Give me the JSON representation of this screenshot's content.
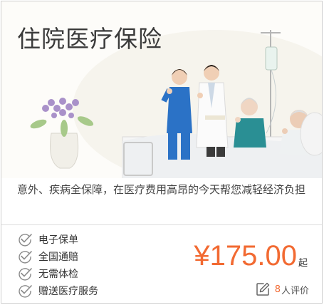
{
  "card": {
    "title": "住院医疗保险",
    "description": "意外、疾病全保障，在医疗费用高昂的今天帮您减轻经济负担",
    "features": [
      {
        "icon": "check-circle-icon",
        "label": "电子保单"
      },
      {
        "icon": "check-circle-icon",
        "label": "全国通赔"
      },
      {
        "icon": "check-circle-icon",
        "label": "无需体检"
      },
      {
        "icon": "check-circle-icon",
        "label": "赠送医疗服务"
      }
    ],
    "price": {
      "amount": "¥175.00",
      "suffix": "起"
    },
    "reviews": {
      "icon": "edit-icon",
      "count": "8",
      "label": "人评价"
    }
  },
  "colors": {
    "accent": "#f26a32",
    "text": "#333333",
    "border": "#cfcfcf"
  }
}
